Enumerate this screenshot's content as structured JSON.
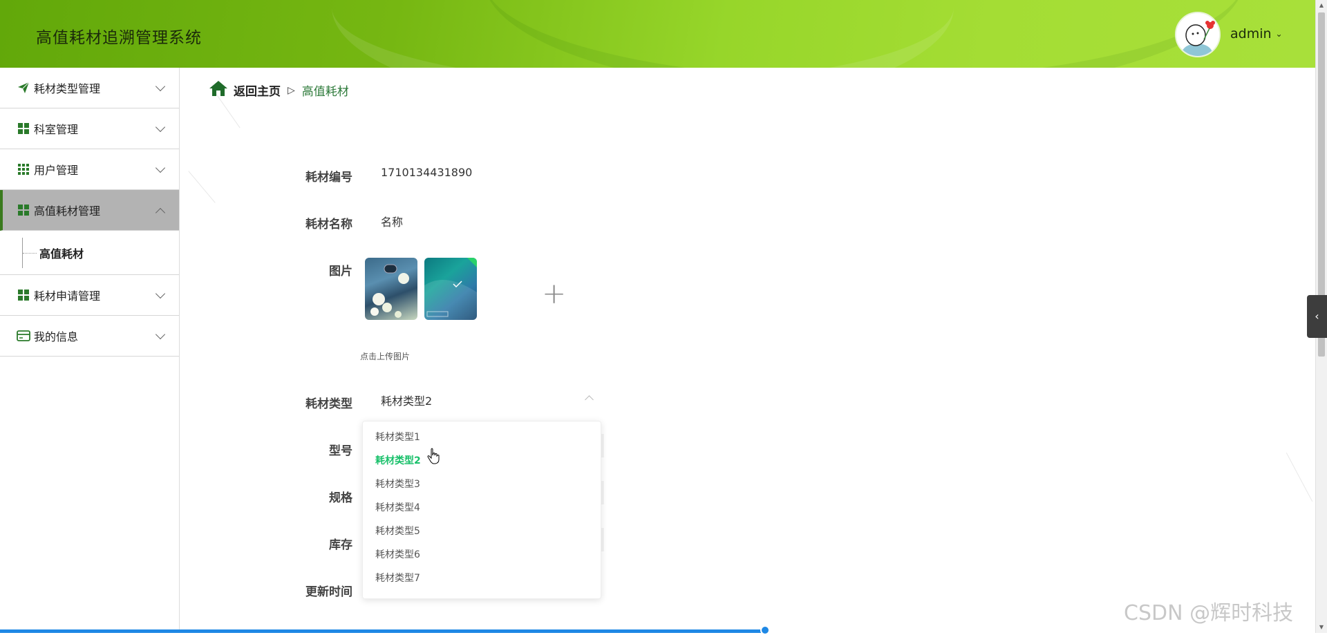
{
  "header": {
    "title": "高值耗材追溯管理系统",
    "username": "admin"
  },
  "sidebar": {
    "items": [
      {
        "label": "耗材类型管理",
        "icon": "paper-plane-icon"
      },
      {
        "label": "科室管理",
        "icon": "grid-icon"
      },
      {
        "label": "用户管理",
        "icon": "apps-grid-icon"
      },
      {
        "label": "高值耗材管理",
        "icon": "grid-icon"
      },
      {
        "label": "耗材申请管理",
        "icon": "grid-icon"
      },
      {
        "label": "我的信息",
        "icon": "card-icon"
      }
    ],
    "sub_item": "高值耗材"
  },
  "breadcrumb": {
    "home": "返回主页",
    "current": "高值耗材"
  },
  "form": {
    "code_label": "耗材编号",
    "code_value": "1710134431890",
    "name_label": "耗材名称",
    "name_value": "名称",
    "image_label": "图片",
    "upload_tip": "点击上传图片",
    "type_label": "耗材类型",
    "type_value": "耗材类型2",
    "model_label": "型号",
    "spec_label": "规格",
    "stock_label": "库存",
    "update_label": "更新时间"
  },
  "dropdown": {
    "options": [
      "耗材类型1",
      "耗材类型2",
      "耗材类型3",
      "耗材类型4",
      "耗材类型5",
      "耗材类型6",
      "耗材类型7"
    ],
    "selected_index": 1
  },
  "colors": {
    "accent_green": "#18c06a",
    "header_green": "#76b712",
    "breadcrumb_green": "#2d7a3a"
  },
  "watermark": "CSDN @辉时科技"
}
